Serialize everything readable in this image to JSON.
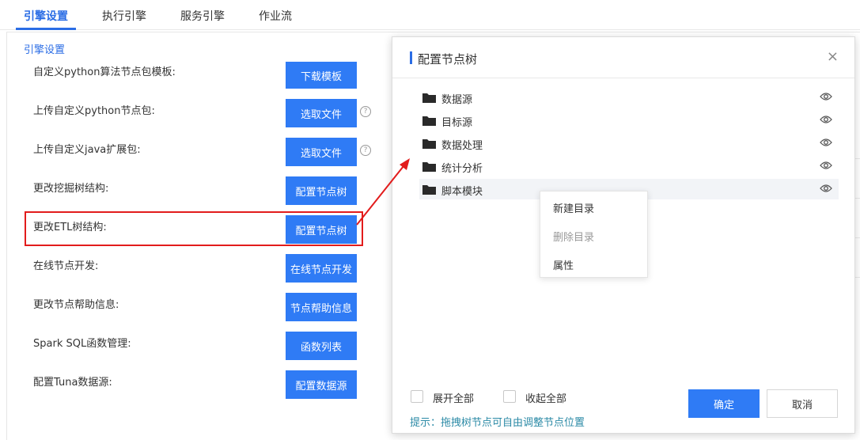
{
  "tabs": [
    {
      "label": "引擎设置",
      "active": true
    },
    {
      "label": "执行引擎",
      "active": false
    },
    {
      "label": "服务引擎",
      "active": false
    },
    {
      "label": "作业流",
      "active": false
    }
  ],
  "section_title": "引擎设置",
  "rows": [
    {
      "label": "自定义python算法节点包模板:",
      "button": "下载模板",
      "help": false
    },
    {
      "label": "上传自定义python节点包:",
      "button": "选取文件",
      "help": true
    },
    {
      "label": "上传自定义java扩展包:",
      "button": "选取文件",
      "help": true
    },
    {
      "label": "更改挖掘树结构:",
      "button": "配置节点树",
      "help": false
    },
    {
      "label": "更改ETL树结构:",
      "button": "配置节点树",
      "help": false
    },
    {
      "label": "在线节点开发:",
      "button": "在线节点开发",
      "help": false
    },
    {
      "label": "更改节点帮助信息:",
      "button": "节点帮助信息",
      "help": false
    },
    {
      "label": "Spark SQL函数管理:",
      "button": "函数列表",
      "help": false
    },
    {
      "label": "配置Tuna数据源:",
      "button": "配置数据源",
      "help": false
    }
  ],
  "help_glyph": "?",
  "modal": {
    "title": "配置节点树",
    "close_glyph": "×",
    "tree": [
      {
        "label": "数据源"
      },
      {
        "label": "目标源"
      },
      {
        "label": "数据处理"
      },
      {
        "label": "统计分析"
      },
      {
        "label": "脚本模块"
      }
    ],
    "context_menu": [
      {
        "label": "新建目录",
        "disabled": false
      },
      {
        "label": "删除目录",
        "disabled": true
      },
      {
        "label": "属性",
        "disabled": false
      }
    ],
    "expand_all": "展开全部",
    "collapse_all": "收起全部",
    "hint": "提示：拖拽树节点可自由调整节点位置",
    "ok": "确定",
    "cancel": "取消"
  },
  "colors": {
    "primary": "#2f7bf5",
    "highlight": "#e21c1c",
    "hint": "#2b8aa6"
  }
}
